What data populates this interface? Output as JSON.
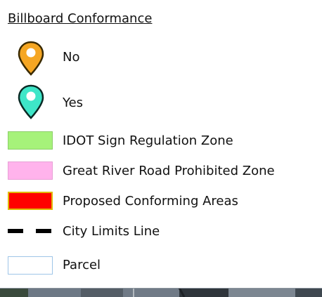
{
  "legend": {
    "title": "Billboard Conformance",
    "items": [
      {
        "type": "pin",
        "label": "No",
        "icon": "map-pin-orange",
        "fill": "#f5a623",
        "stroke": "#3a2a00"
      },
      {
        "type": "pin",
        "label": "Yes",
        "icon": "map-pin-teal",
        "fill": "#3ee6c8",
        "stroke": "#0a2a25"
      },
      {
        "type": "swatch",
        "label": "IDOT Sign Regulation Zone",
        "fill": "#a6f27a",
        "stroke": "#8ccf69"
      },
      {
        "type": "swatch",
        "label": "Great River Road Prohibited Zone",
        "fill": "#ffb3ec",
        "stroke": "#e7a0d6"
      },
      {
        "type": "swatch",
        "label": "Proposed Conforming Areas",
        "fill": "#ff0000",
        "stroke": "#e0b800"
      },
      {
        "type": "line",
        "label": "City Limits Line",
        "icon": "dashed-line",
        "stroke": "#000000"
      },
      {
        "type": "swatch",
        "label": "Parcel",
        "fill": "#ffffff",
        "stroke": "#9ec5e8"
      }
    ]
  },
  "colors": {
    "background": "#ffffff",
    "text": "#111111",
    "imagery": "#4b5561"
  }
}
